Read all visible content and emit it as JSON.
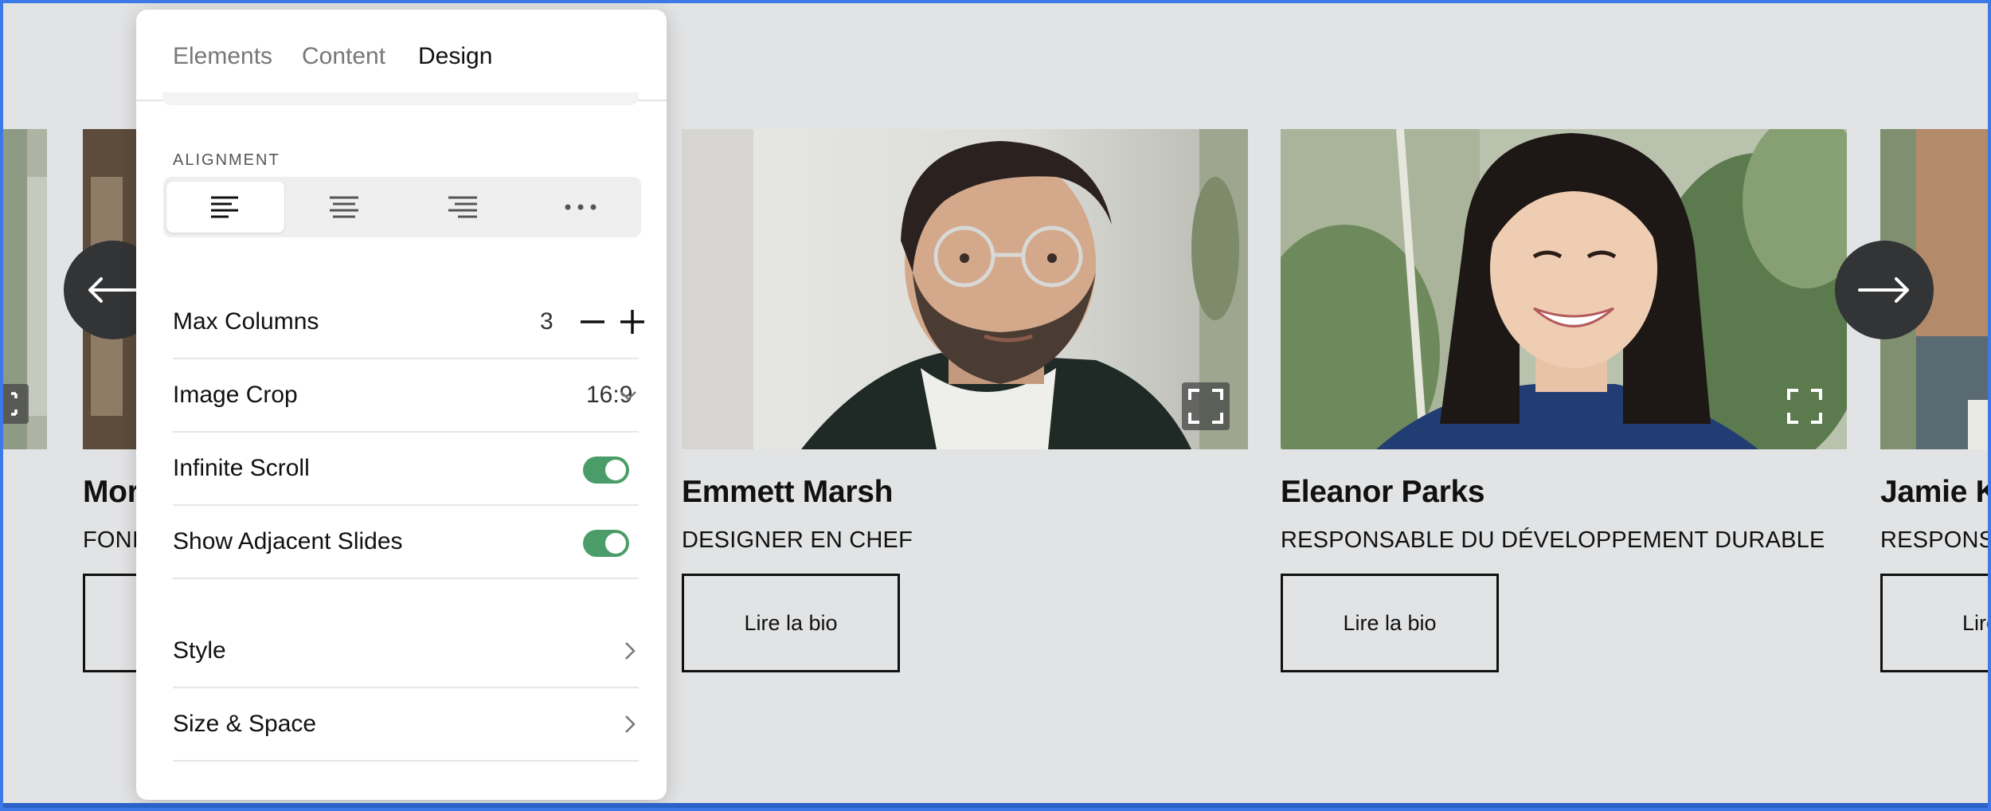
{
  "panel": {
    "tabs": [
      {
        "label": "Elements"
      },
      {
        "label": "Content"
      },
      {
        "label": "Design"
      }
    ],
    "active_tab": "Design",
    "alignment": {
      "label": "ALIGNMENT",
      "options": [
        "align-left",
        "align-center",
        "align-right",
        "more"
      ],
      "selected": "align-left"
    },
    "max_columns": {
      "label": "Max Columns",
      "value": "3"
    },
    "image_crop": {
      "label": "Image Crop",
      "value": "16:9"
    },
    "infinite_scroll": {
      "label": "Infinite Scroll",
      "enabled": true
    },
    "show_adjacent": {
      "label": "Show Adjacent Slides",
      "enabled": true
    },
    "style": {
      "label": "Style"
    },
    "size_space": {
      "label": "Size & Space"
    }
  },
  "slides": [
    {
      "name": "Mor",
      "role": "FONI",
      "button": ""
    },
    {
      "name": "Emmett Marsh",
      "role": "DESIGNER EN CHEF",
      "button": "Lire la bio"
    },
    {
      "name": "Eleanor Parks",
      "role": "RESPONSABLE DU DÉVELOPPEMENT DURABLE",
      "button": "Lire la bio"
    },
    {
      "name": "Jamie K",
      "role": "RESPONS",
      "button": "Lire l"
    }
  ],
  "colors": {
    "background": "#e2e3e4",
    "frame_border": "#3c78e6",
    "toggle_on": "#4a9d68",
    "arrow_button": "#333436"
  }
}
